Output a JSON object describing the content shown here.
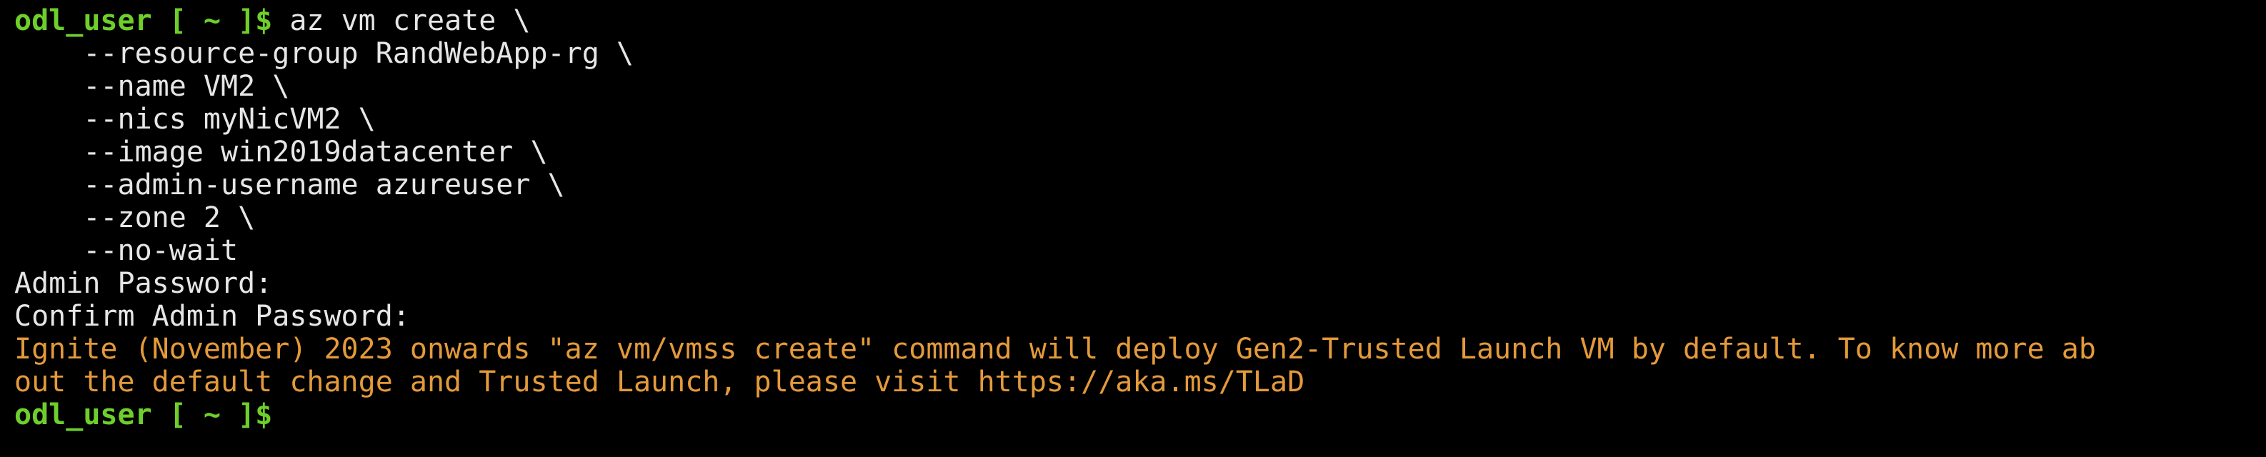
{
  "terminal": {
    "prompt": "odl_user [ ~ ]$",
    "command_lines": [
      "az vm create \\",
      "    --resource-group RandWebApp-rg \\",
      "    --name VM2 \\",
      "    --nics myNicVM2 \\",
      "    --image win2019datacenter \\",
      "    --admin-username azureuser \\",
      "    --zone 2 \\",
      "    --no-wait"
    ],
    "output_lines": [
      "Admin Password:",
      "Confirm Admin Password:"
    ],
    "warning_lines": [
      "Ignite (November) 2023 onwards \"az vm/vmss create\" command will deploy Gen2-Trusted Launch VM by default. To know more ab",
      "out the default change and Trusted Launch, please visit https://aka.ms/TLaD"
    ],
    "final_prompt": "odl_user [ ~ ]$"
  },
  "colors": {
    "background": "#000000",
    "prompt": "#6ecf2b",
    "text": "#e6e6e6",
    "warning": "#e49a3a"
  }
}
